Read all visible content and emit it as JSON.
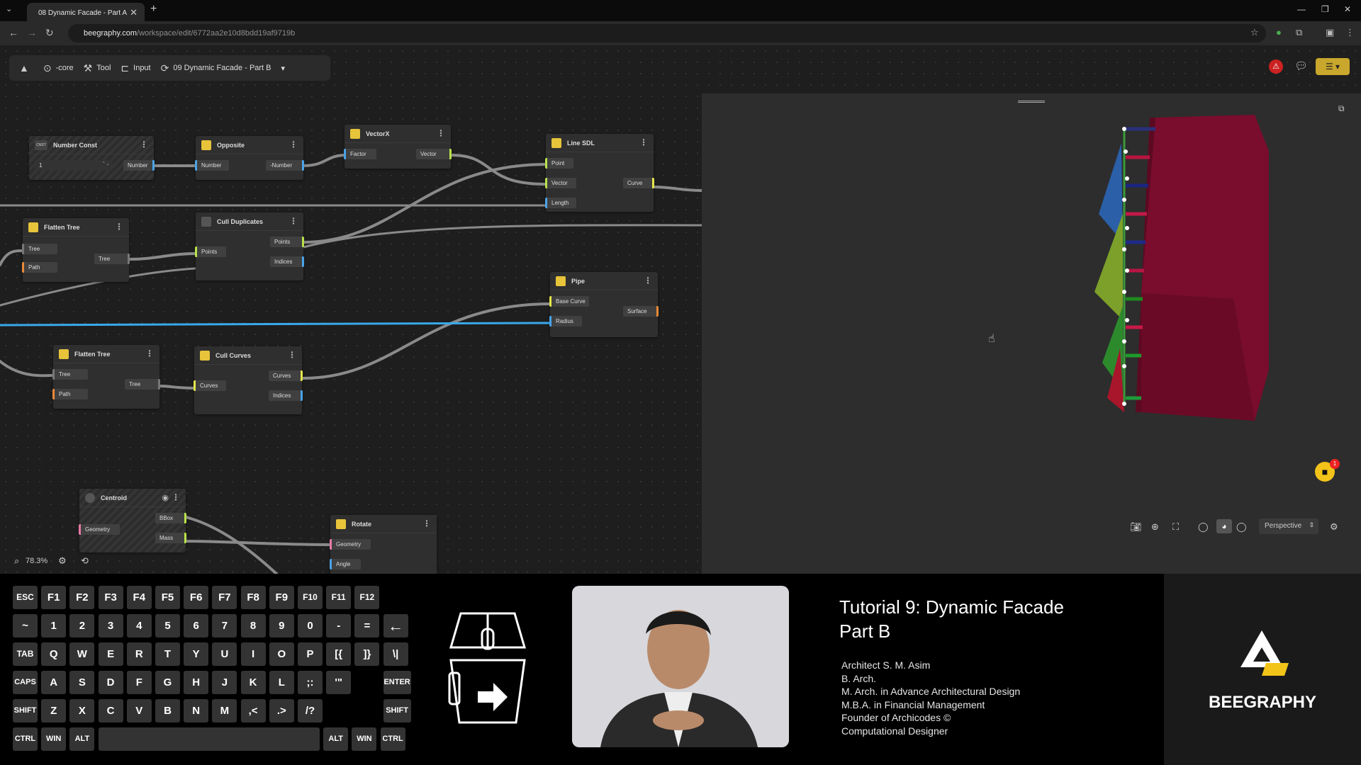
{
  "browser": {
    "tab_title": "08 Dynamic Facade - Part A",
    "url_domain": "beegraphy.com",
    "url_path": "/workspace/edit/6772aa2e10d8bdd19af9719b"
  },
  "toolbar": {
    "core": "-core",
    "tool": "Tool",
    "input": "Input",
    "project": "09 Dynamic Facade - Part B"
  },
  "nodes": {
    "number_const": {
      "title": "Number Const",
      "value": "1",
      "out": "Number",
      "badge": "CNST"
    },
    "opposite": {
      "title": "Opposite",
      "in": "Number",
      "out": "-Number"
    },
    "vectorx": {
      "title": "VectorX",
      "in": "Factor",
      "out": "Vector"
    },
    "line_sdl": {
      "title": "Line SDL",
      "in1": "Point",
      "in2": "Vector",
      "in3": "Length",
      "out": "Curve"
    },
    "flatten1": {
      "title": "Flatten Tree",
      "in1": "Tree",
      "in2": "Path",
      "out": "Tree"
    },
    "cull_dup": {
      "title": "Cull Duplicates",
      "in": "Points",
      "out1": "Points",
      "out2": "Indices"
    },
    "pipe": {
      "title": "Pipe",
      "in1": "Base Curve",
      "in2": "Radius",
      "out": "Surface"
    },
    "flatten2": {
      "title": "Flatten Tree",
      "in1": "Tree",
      "in2": "Path",
      "out": "Tree"
    },
    "cull_curves": {
      "title": "Cull Curves",
      "in": "Curves",
      "out1": "Curves",
      "out2": "Indices"
    },
    "centroid": {
      "title": "Centroid",
      "in": "Geometry",
      "out1": "BBox",
      "out2": "Mass"
    },
    "rotate": {
      "title": "Rotate",
      "in1": "Geometry",
      "in2": "Angle"
    }
  },
  "canvas": {
    "zoom": "78.3%"
  },
  "viewport": {
    "camera": "Perspective",
    "notification_count": "1"
  },
  "keyboard": {
    "row1": [
      "ESC",
      "F1",
      "F2",
      "F3",
      "F4",
      "F5",
      "F6",
      "F7",
      "F8",
      "F9",
      "F10",
      "F11",
      "F12"
    ],
    "row2": [
      "~",
      "1",
      "2",
      "3",
      "4",
      "5",
      "6",
      "7",
      "8",
      "9",
      "0",
      "-",
      "="
    ],
    "row3": [
      "TAB",
      "Q",
      "W",
      "E",
      "R",
      "T",
      "Y",
      "U",
      "I",
      "O",
      "P",
      "[{",
      "]}",
      "\\|"
    ],
    "row4": [
      "CAPS",
      "A",
      "S",
      "D",
      "F",
      "G",
      "H",
      "J",
      "K",
      "L",
      ";:",
      "'\""
    ],
    "row5": [
      "SHIFT",
      "Z",
      "X",
      "C",
      "V",
      "B",
      "N",
      "M",
      ",<",
      ".>",
      "/?"
    ],
    "enter": "ENTER",
    "shift_r": "SHIFT",
    "ctrl": "CTRL",
    "win": "WIN",
    "alt": "ALT"
  },
  "tutorial": {
    "title1": "Tutorial 9: Dynamic Facade",
    "title2": "Part B",
    "credits": [
      "Architect S. M. Asim",
      "B. Arch.",
      "M. Arch. in Advance Architectural Design",
      "M.B.A. in Financial Management",
      "Founder of Archicodes ©",
      "Computational Designer"
    ]
  },
  "brand": {
    "logo_text": "BEEGRAPHY"
  },
  "colors": {
    "accent": "#e6c33a",
    "wire": "#8a8a8a",
    "wire_blue": "#39a9ea",
    "facade": "#7a0c2e"
  }
}
